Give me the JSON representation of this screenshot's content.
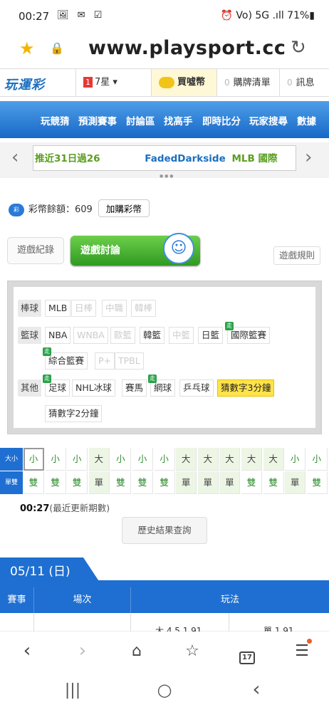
{
  "status_bar": {
    "time": "00:27",
    "left_icons": "🖼 ✉ ☑",
    "right_text": "⏰ Vo) 5G .ıll 71%▮"
  },
  "browser": {
    "url": "www.playsport.cc"
  },
  "site_header": {
    "logo": "玩運彩",
    "notification_count": "1",
    "stars": "7星",
    "stars_caret": "▾",
    "buy_coins": "買噓幣",
    "cart_count": "0",
    "cart": "購牌清單",
    "msg_count": "0",
    "messages": "訊息"
  },
  "top_nav": [
    "玩競猜",
    "預測賽事",
    "討論區",
    "找高手",
    "即時比分",
    "玩家搜尋",
    "數據"
  ],
  "ticker": {
    "text_green": "推近31日過26",
    "text_user": "FadedDarkside",
    "text_league": "MLB 國際"
  },
  "balance": {
    "label": "彩幣餘額：609",
    "add_button": "加購彩幣",
    "icon_text": "彩"
  },
  "tabs": {
    "records": "遊戲紀錄",
    "discussion": "遊戲討論",
    "rules": "遊戲規則"
  },
  "categories": {
    "baseball_label": "棒球",
    "baseball": [
      "MLB",
      "日棒",
      "中職",
      "韓棒"
    ],
    "basketball_label": "籃球",
    "basketball": [
      "NBA",
      "WNBA",
      "歐籃",
      "韓籃",
      "中籃",
      "日籃",
      "國際籃賽",
      "綜合籃賽",
      "P+",
      "TPBL"
    ],
    "other_label": "其他",
    "other": [
      "足球",
      "NHL冰球",
      "賽馬",
      "網球",
      "乒乓球",
      "猜數字3分鐘",
      "猜數字2分鐘"
    ],
    "walk_badge": "走"
  },
  "trend": {
    "size_label": "大小",
    "parity_label": "單雙",
    "size": [
      "小",
      "小",
      "小",
      "大",
      "小",
      "小",
      "小",
      "大",
      "大",
      "大",
      "大",
      "大",
      "小",
      "小"
    ],
    "parity": [
      "雙",
      "雙",
      "雙",
      "單",
      "雙",
      "雙",
      "雙",
      "單",
      "單",
      "單",
      "雙",
      "雙",
      "單",
      "雙"
    ]
  },
  "update": {
    "time": "00:27",
    "note": "(最近更新期數)"
  },
  "history_button": "歷史結果查詢",
  "date_header": "05/11 (日)",
  "table_header": {
    "col1": "賽事",
    "col2": "場次",
    "col3": "玩法"
  },
  "table_partial": {
    "left": "大 4.5 1.91",
    "right": "單 1.91"
  },
  "browser_nav": {
    "tab_count": "17"
  }
}
